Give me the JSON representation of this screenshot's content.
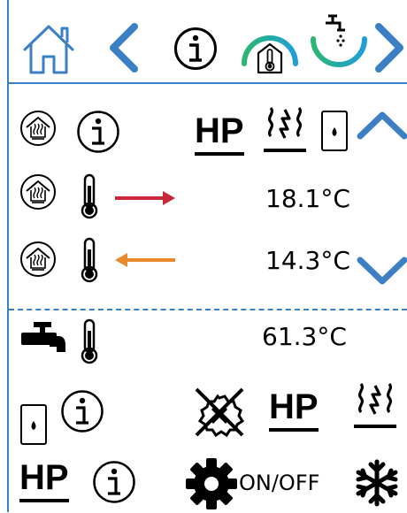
{
  "header": {
    "home_icon": "home-icon",
    "back_icon": "chevron-left-icon",
    "info_icon": "info-icon",
    "gauge_heating_icon": "heating-temperature-gauge-icon",
    "gauge_water_icon": "hot-water-gauge-icon",
    "next_icon": "chevron-right-icon"
  },
  "heating": {
    "header_hp_label": "HP",
    "flow_temperature": "18.1°C",
    "return_temperature": "14.3°C"
  },
  "hot_water": {
    "temperature": "61.3°C",
    "hp_label": "HP"
  },
  "heat_pump": {
    "label": "HP",
    "onoff_label": "ON/OFF"
  },
  "colors": {
    "accent": "#3b7fc4",
    "flow_arrow": "#c8283a",
    "return_arrow": "#e8892b",
    "gauge_start": "#2bb673",
    "gauge_end": "#1e9fd8"
  }
}
